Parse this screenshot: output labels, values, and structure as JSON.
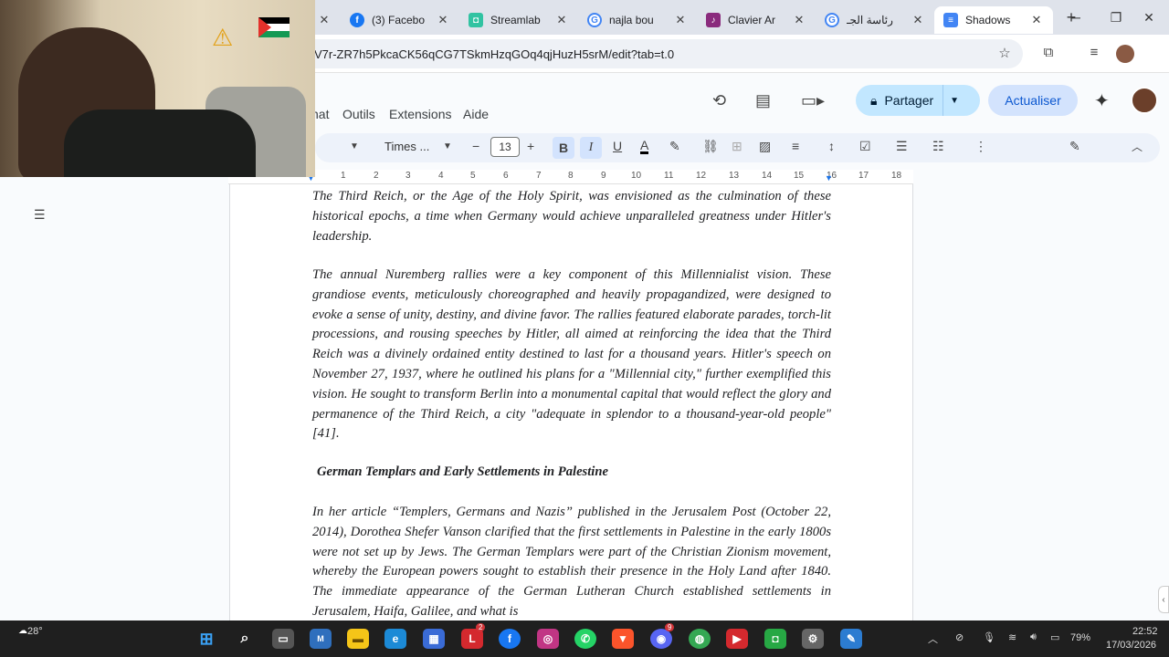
{
  "browser": {
    "tabs": [
      {
        "title": "",
        "icon": "generic-tab-icon",
        "active": false
      },
      {
        "title": "(3) Facebo",
        "icon": "facebook-icon",
        "active": false
      },
      {
        "title": "Streamlab",
        "icon": "streamlabs-icon",
        "active": false
      },
      {
        "title": "najla bou",
        "icon": "google-icon",
        "active": false
      },
      {
        "title": "Clavier Ar",
        "icon": "clavier-icon",
        "active": false
      },
      {
        "title": "رئاسة الجـ",
        "icon": "google-icon",
        "active": false
      },
      {
        "title": "Shadows",
        "icon": "docs-icon",
        "active": true
      }
    ],
    "url": "V7r-ZR7h5PkcaCK56qCG7TSkmHzqGOq4qjHuzH5srM/edit?tab=t.0"
  },
  "docs": {
    "menu": [
      "nat",
      "Outils",
      "Extensions",
      "Aide"
    ],
    "share_label": "Partager",
    "update_label": "Actualiser",
    "font_family": "Times ...",
    "font_size": "13",
    "ruler_numbers": [
      "1",
      "2",
      "3",
      "4",
      "5",
      "6",
      "7",
      "8",
      "9",
      "10",
      "11",
      "12",
      "13",
      "14",
      "15",
      "16",
      "17",
      "18"
    ]
  },
  "document": {
    "para1": "The Third Reich, or the Age of the Holy Spirit, was envisioned as the culmination of these historical epochs, a time when Germany would achieve unparalleled greatness under Hitler's leadership.",
    "para2": "The annual Nuremberg rallies were a key component of this Millennialist vision. These grandiose events, meticulously choreographed and heavily propagandized, were designed to evoke a sense of unity, destiny, and divine favor. The rallies featured elaborate parades, torch-lit processions, and rousing speeches by Hitler, all aimed at reinforcing the idea that the Third Reich was a divinely ordained entity destined to last for a thousand years. Hitler's speech on November 27, 1937, where he outlined his plans for a \"Millennial city,\" further exemplified this vision. He sought to transform Berlin into a monumental capital that would reflect the glory and permanence of the Third Reich, a city \"adequate in splendor to a thousand-year-old people\" [41].",
    "heading": "German Templars and Early Settlements in Palestine",
    "para3": "In her article “Templers, Germans and Nazis” published in the Jerusalem Post (October 22, 2014), Dorothea Shefer Vanson clarified that the first settlements in Palestine in the early 1800s were not set up by Jews. The German Templars were part of the Christian Zionism movement, whereby the European powers sought to establish their presence in the Holy Land after 1840. The immediate appearance of the German Lutheran Church established settlements in Jerusalem, Haifa, Galilee, and what is"
  },
  "taskbar": {
    "temperature": "28°",
    "battery": "79%",
    "time": "22:52",
    "date": "17/03/2026",
    "badge_l": "2",
    "badge_discord": "9"
  },
  "colors": {
    "share_bg": "#c2e7ff",
    "update_bg": "#d3e3fd",
    "toolbar_bg": "#edf2fa",
    "taskbar_bg": "#1f1f1f"
  }
}
